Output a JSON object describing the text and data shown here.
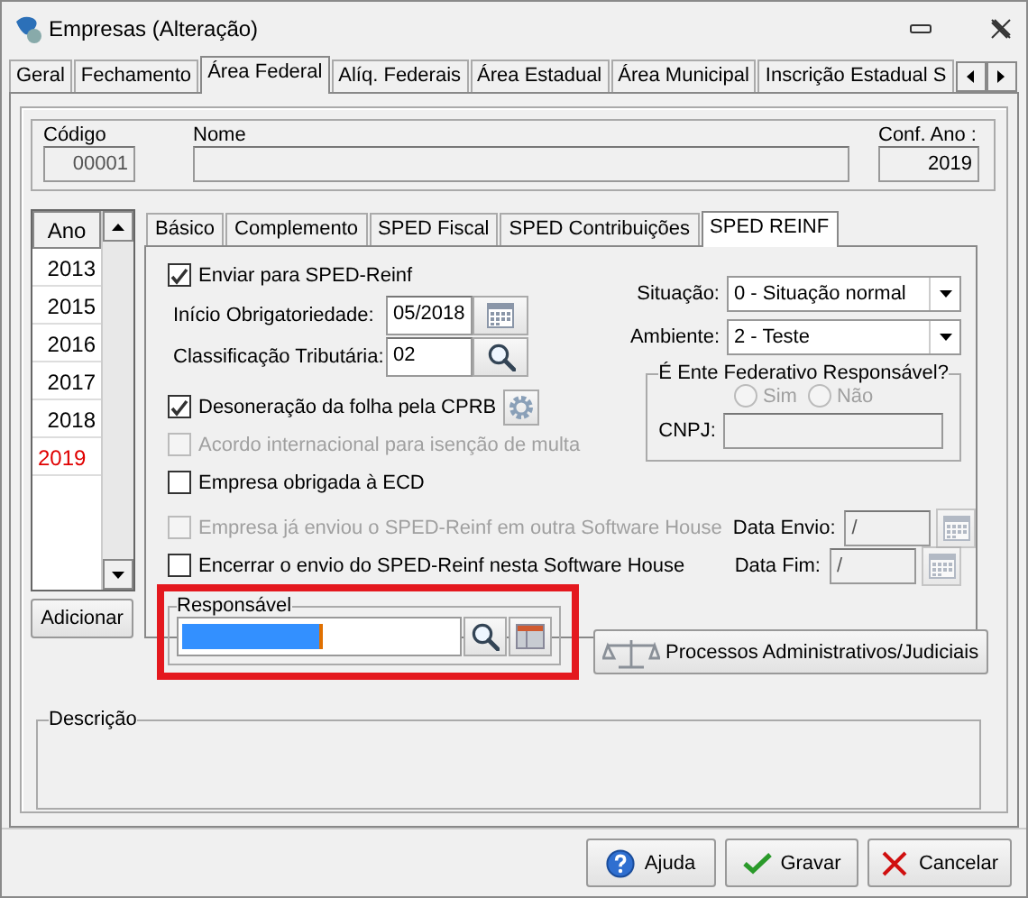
{
  "window": {
    "title": "Empresas (Alteração)"
  },
  "tabs": [
    {
      "label": "Geral",
      "selected": false
    },
    {
      "label": "Fechamento",
      "selected": false
    },
    {
      "label": "Área Federal",
      "selected": true
    },
    {
      "label": "Alíq. Federais",
      "selected": false
    },
    {
      "label": "Área Estadual",
      "selected": false
    },
    {
      "label": "Área Municipal",
      "selected": false
    },
    {
      "label": "Inscrição Estadual S",
      "selected": false
    }
  ],
  "header": {
    "codigo": {
      "label": "Código",
      "value": "00001"
    },
    "nome": {
      "label": "Nome"
    },
    "conf_ano": {
      "label": "Conf. Ano :",
      "value": "2019"
    }
  },
  "years": {
    "column": "Ano",
    "rows": [
      {
        "label": "2013",
        "selected": false
      },
      {
        "label": "2015",
        "selected": false
      },
      {
        "label": "2016",
        "selected": false
      },
      {
        "label": "2017",
        "selected": false
      },
      {
        "label": "2018",
        "selected": false
      },
      {
        "label": "2019",
        "selected": true
      }
    ],
    "add_button": "Adicionar"
  },
  "subtabs": [
    {
      "label": "Básico",
      "selected": false
    },
    {
      "label": "Complemento",
      "selected": false
    },
    {
      "label": "SPED Fiscal",
      "selected": false
    },
    {
      "label": "SPED Contribuições",
      "selected": false
    },
    {
      "label": "SPED REINF",
      "selected": true
    }
  ],
  "options": [
    {
      "kind": "checkbox",
      "label": "Enviar para SPED-Reinf",
      "checked": true,
      "disabled": false,
      "settings": false
    },
    {
      "kind": "date",
      "label": "Início Obrigatoriedade:",
      "value": "05/2018"
    },
    {
      "kind": "lookup",
      "label": "Classificação Tributária:",
      "value": "02"
    },
    {
      "kind": "checkbox",
      "label": "Desoneração da folha pela CPRB",
      "checked": true,
      "disabled": false,
      "settings": true
    },
    {
      "kind": "checkbox",
      "label": "Acordo internacional para isenção de multa",
      "checked": false,
      "disabled": true,
      "settings": false
    },
    {
      "kind": "checkbox",
      "label": "Empresa obrigada à ECD",
      "checked": false,
      "disabled": false,
      "settings": false
    }
  ],
  "situacao": {
    "label": "Situação:",
    "value": "0 - Situação normal"
  },
  "ambiente": {
    "label": "Ambiente:",
    "value": "2 - Teste"
  },
  "ente": {
    "title": "É Ente Federativo Responsável?",
    "options": [
      {
        "label": "Sim",
        "selected": false,
        "disabled": true
      },
      {
        "label": "Não",
        "selected": false,
        "disabled": true
      }
    ],
    "cnpj_label": "CNPJ:"
  },
  "date_rows": [
    {
      "check": {
        "label": "Empresa já enviou o SPED-Reinf em outra Software House",
        "checked": false,
        "disabled": true
      },
      "date": {
        "label": "Data Envio:",
        "value": "/",
        "disabled": true
      }
    },
    {
      "check": {
        "label": "Encerrar o envio do SPED-Reinf nesta Software House",
        "checked": false,
        "disabled": false
      },
      "date": {
        "label": "Data Fim:",
        "value": "/",
        "disabled": true
      }
    }
  ],
  "responsavel": {
    "title": "Responsável"
  },
  "processos_button": "Processos Administrativos/Judiciais",
  "descricao": {
    "title": "Descrição"
  },
  "buttons": [
    {
      "kind": "help",
      "label": "Ajuda"
    },
    {
      "kind": "save",
      "label": "Gravar"
    },
    {
      "kind": "cancel",
      "label": "Cancelar"
    }
  ]
}
